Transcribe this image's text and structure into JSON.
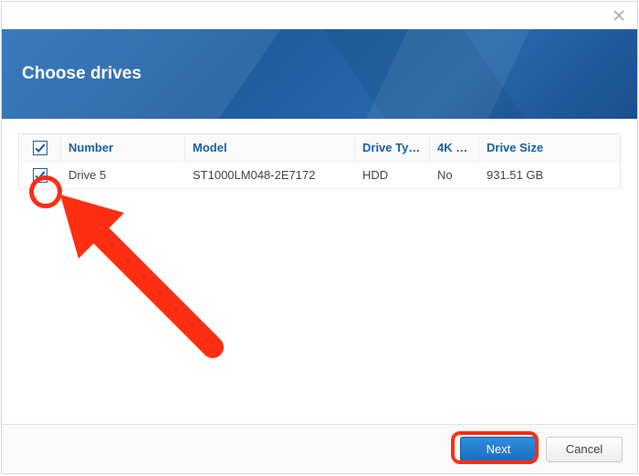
{
  "header": {
    "title": "Choose drives"
  },
  "table": {
    "columns": {
      "number": "Number",
      "model": "Model",
      "driveType": "Drive Ty…",
      "fourK": "4K …",
      "driveSize": "Drive Size"
    },
    "rows": [
      {
        "checked": true,
        "number": "Drive 5",
        "model": "ST1000LM048-2E7172",
        "driveType": "HDD",
        "fourK": "No",
        "driveSize": "931.51 GB"
      }
    ]
  },
  "buttons": {
    "next": "Next",
    "cancel": "Cancel"
  }
}
